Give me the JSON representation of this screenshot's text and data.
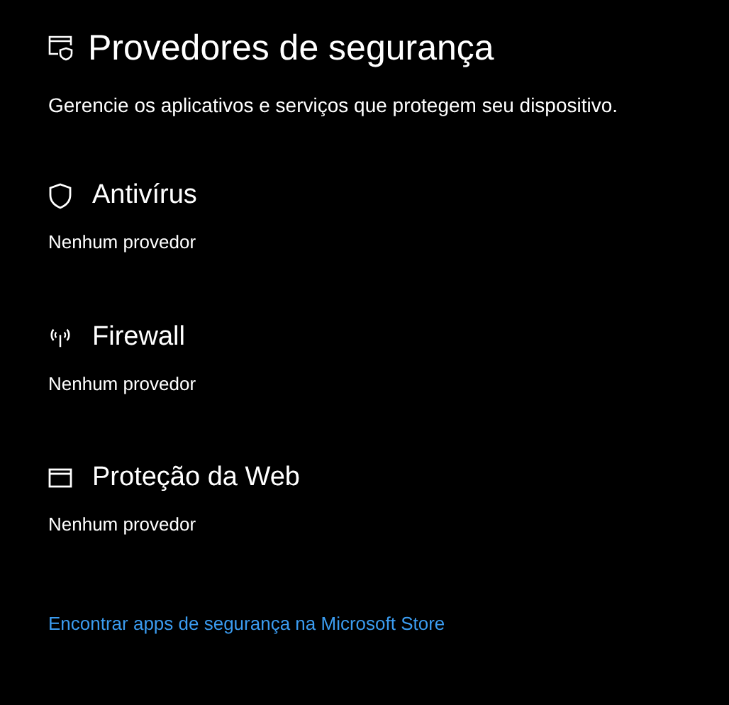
{
  "title": "Provedores de segurança",
  "description": "Gerencie os aplicativos e serviços que protegem seu dispositivo.",
  "sections": [
    {
      "kind": "antivirus",
      "heading": "Antivírus",
      "status": "Nenhum provedor"
    },
    {
      "kind": "firewall",
      "heading": "Firewall",
      "status": "Nenhum provedor"
    },
    {
      "kind": "web",
      "heading": "Proteção da Web",
      "status": "Nenhum provedor"
    }
  ],
  "link": "Encontrar apps de segurança na Microsoft Store"
}
